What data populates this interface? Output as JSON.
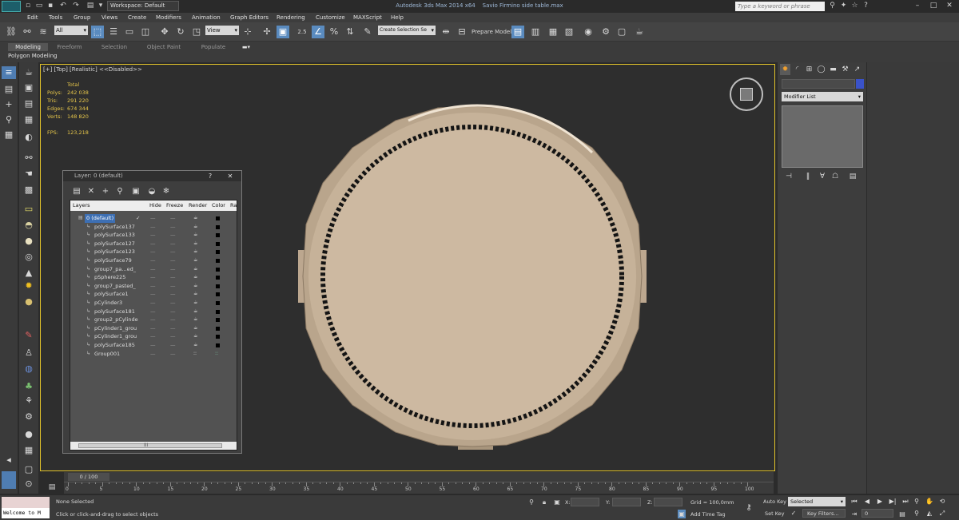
{
  "title_bar": {
    "workspace": "Workspace: Default",
    "app_title": "Autodesk 3ds Max  2014 x64",
    "file_title": "Savio Firmino side table.max",
    "search_placeholder": "Type a keyword or phrase"
  },
  "menu": [
    "Edit",
    "Tools",
    "Group",
    "Views",
    "Create",
    "Modifiers",
    "Animation",
    "Graph Editors",
    "Rendering",
    "Customize",
    "MAXScript",
    "Help"
  ],
  "toolbar": {
    "filter_select": "All",
    "coord_select": "View",
    "snap_label": "2.5",
    "named_selection": "Create Selection Se",
    "prepare_model": "Prepare Model"
  },
  "ribbon": {
    "tabs": [
      "Modeling",
      "Freeform",
      "Selection",
      "Object Paint",
      "Populate"
    ],
    "active_tab": "Modeling",
    "panel_label": "Polygon Modeling"
  },
  "viewport": {
    "label": "[+] [Top] [Realistic]  <<Disabled>>",
    "stats": {
      "header": "Total",
      "polys_label": "Polys:",
      "polys": "242 038",
      "tris_label": "Tris:",
      "tris": "291 220",
      "edges_label": "Edges:",
      "edges": "674 344",
      "verts_label": "Verts:",
      "verts": "148 820",
      "fps_label": "FPS:",
      "fps": "123,218"
    },
    "colors": {
      "table_top": "#cdb9a1",
      "rim": "#b9a58c",
      "bead": "#111111",
      "viewport_bg": "#2e2e2e"
    }
  },
  "layer_dialog": {
    "title": "Layer: 0 (default)",
    "help": "?",
    "close": "✕",
    "columns": [
      "Layers",
      "Hide",
      "Freeze",
      "Render",
      "Color",
      "Rad"
    ],
    "rows": [
      "0 (default)",
      "polySurface137",
      "polySurface133",
      "polySurface127",
      "polySurface123",
      "polySurface79",
      "group7_pa...ed_",
      "pSphere225",
      "group7_pasted_",
      "polySurface1",
      "pCylinder3",
      "polySurface181",
      "group2_pCylinde",
      "pCylinder1_grou",
      "pCylinder1_grou",
      "polySurface185",
      "Group001"
    ],
    "hscroll_label": "III"
  },
  "command_panel": {
    "modifier_list": "Modifier List",
    "object_color": "#3a52c8"
  },
  "timeline": {
    "frame_range": "0 / 100",
    "ticks": [
      "0",
      "5",
      "10",
      "15",
      "20",
      "25",
      "30",
      "35",
      "40",
      "45",
      "50",
      "55",
      "60",
      "65",
      "70",
      "75",
      "80",
      "85",
      "90",
      "95",
      "100"
    ]
  },
  "status": {
    "welcome": "Welcome to M",
    "selection": "None Selected",
    "prompt": "Click or click-and-drag to select objects",
    "x_label": "X:",
    "y_label": "Y:",
    "z_label": "Z:",
    "grid": "Grid = 100,0mm",
    "add_time_tag": "Add Time Tag",
    "auto_key": "Auto Key",
    "selected": "Selected",
    "set_key": "Set Key",
    "key_filters": "Key Filters...",
    "frame": "0"
  }
}
